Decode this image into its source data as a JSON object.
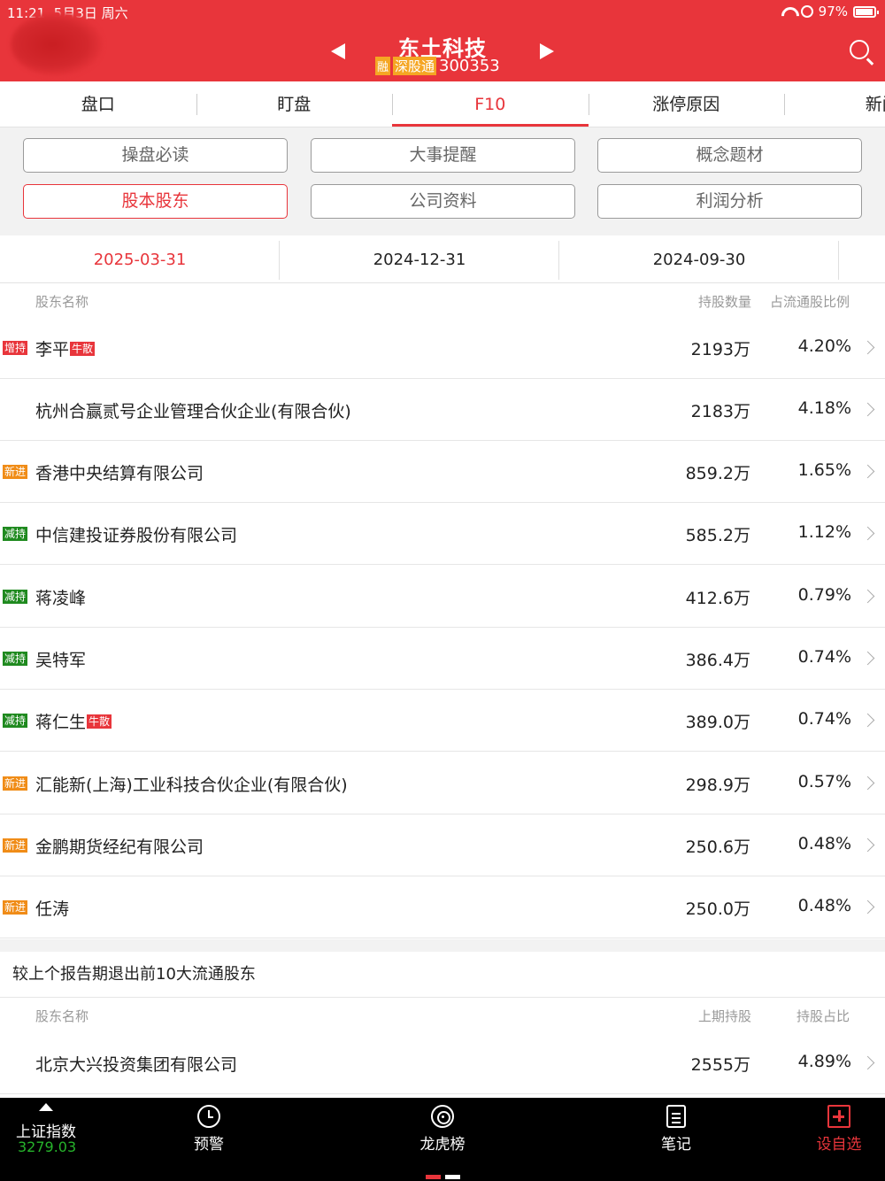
{
  "status": {
    "time": "11:21",
    "date": "5月3日 周六",
    "battery": "97%"
  },
  "header": {
    "stock_name": "东土科技",
    "tag_rong": "融",
    "tag_connect": "深股通",
    "stock_code": "300353"
  },
  "tabs": [
    "盘口",
    "盯盘",
    "F10",
    "涨停原因",
    "新闻"
  ],
  "active_tab": "F10",
  "sub_buttons": [
    "操盘必读",
    "大事提醒",
    "概念题材",
    "股本股东",
    "公司资料",
    "利润分析"
  ],
  "active_sub_button": "股本股东",
  "dates": [
    "2025-03-31",
    "2024-12-31",
    "2024-09-30"
  ],
  "holders_header": {
    "name": "股东名称",
    "qty": "持股数量",
    "pct": "占流通股比例"
  },
  "holders": [
    {
      "badge": "增持",
      "badge_type": "up",
      "name": "李平",
      "tag": "牛散",
      "qty": "2193万",
      "pct": "4.20%"
    },
    {
      "badge": "",
      "badge_type": "",
      "name": "杭州合赢贰号企业管理合伙企业(有限合伙)",
      "tag": "",
      "qty": "2183万",
      "pct": "4.18%"
    },
    {
      "badge": "新进",
      "badge_type": "new",
      "name": "香港中央结算有限公司",
      "tag": "",
      "qty": "859.2万",
      "pct": "1.65%"
    },
    {
      "badge": "减持",
      "badge_type": "down",
      "name": "中信建投证券股份有限公司",
      "tag": "",
      "qty": "585.2万",
      "pct": "1.12%"
    },
    {
      "badge": "减持",
      "badge_type": "down",
      "name": "蒋凌峰",
      "tag": "",
      "qty": "412.6万",
      "pct": "0.79%"
    },
    {
      "badge": "减持",
      "badge_type": "down",
      "name": "吴特军",
      "tag": "",
      "qty": "386.4万",
      "pct": "0.74%"
    },
    {
      "badge": "减持",
      "badge_type": "down",
      "name": "蒋仁生",
      "tag": "牛散",
      "qty": "389.0万",
      "pct": "0.74%"
    },
    {
      "badge": "新进",
      "badge_type": "new",
      "name": "汇能新(上海)工业科技合伙企业(有限合伙)",
      "tag": "",
      "qty": "298.9万",
      "pct": "0.57%"
    },
    {
      "badge": "新进",
      "badge_type": "new",
      "name": "金鹏期货经纪有限公司",
      "tag": "",
      "qty": "250.6万",
      "pct": "0.48%"
    },
    {
      "badge": "新进",
      "badge_type": "new",
      "name": "任涛",
      "tag": "",
      "qty": "250.0万",
      "pct": "0.48%"
    }
  ],
  "exit_section": {
    "title": "较上个报告期退出前10大流通股东",
    "header": {
      "name": "股东名称",
      "qty": "上期持股",
      "pct": "持股占比"
    },
    "rows": [
      {
        "name": "北京大兴投资集团有限公司",
        "qty": "2555万",
        "pct": "4.89%"
      }
    ]
  },
  "bottom_bar": {
    "index_name": "上证指数",
    "index_value": "3279.03",
    "items": [
      {
        "label": "预警",
        "icon": "alarm-icon"
      },
      {
        "label": "龙虎榜",
        "icon": "target-icon"
      },
      {
        "label": "笔记",
        "icon": "note-icon"
      },
      {
        "label": "设自选",
        "icon": "add-icon"
      }
    ]
  },
  "colors": {
    "brand": "#e8353b",
    "increase": "#e8353b",
    "decrease": "#1f8a1f",
    "new": "#f08c17",
    "index_value": "#26b32b"
  }
}
